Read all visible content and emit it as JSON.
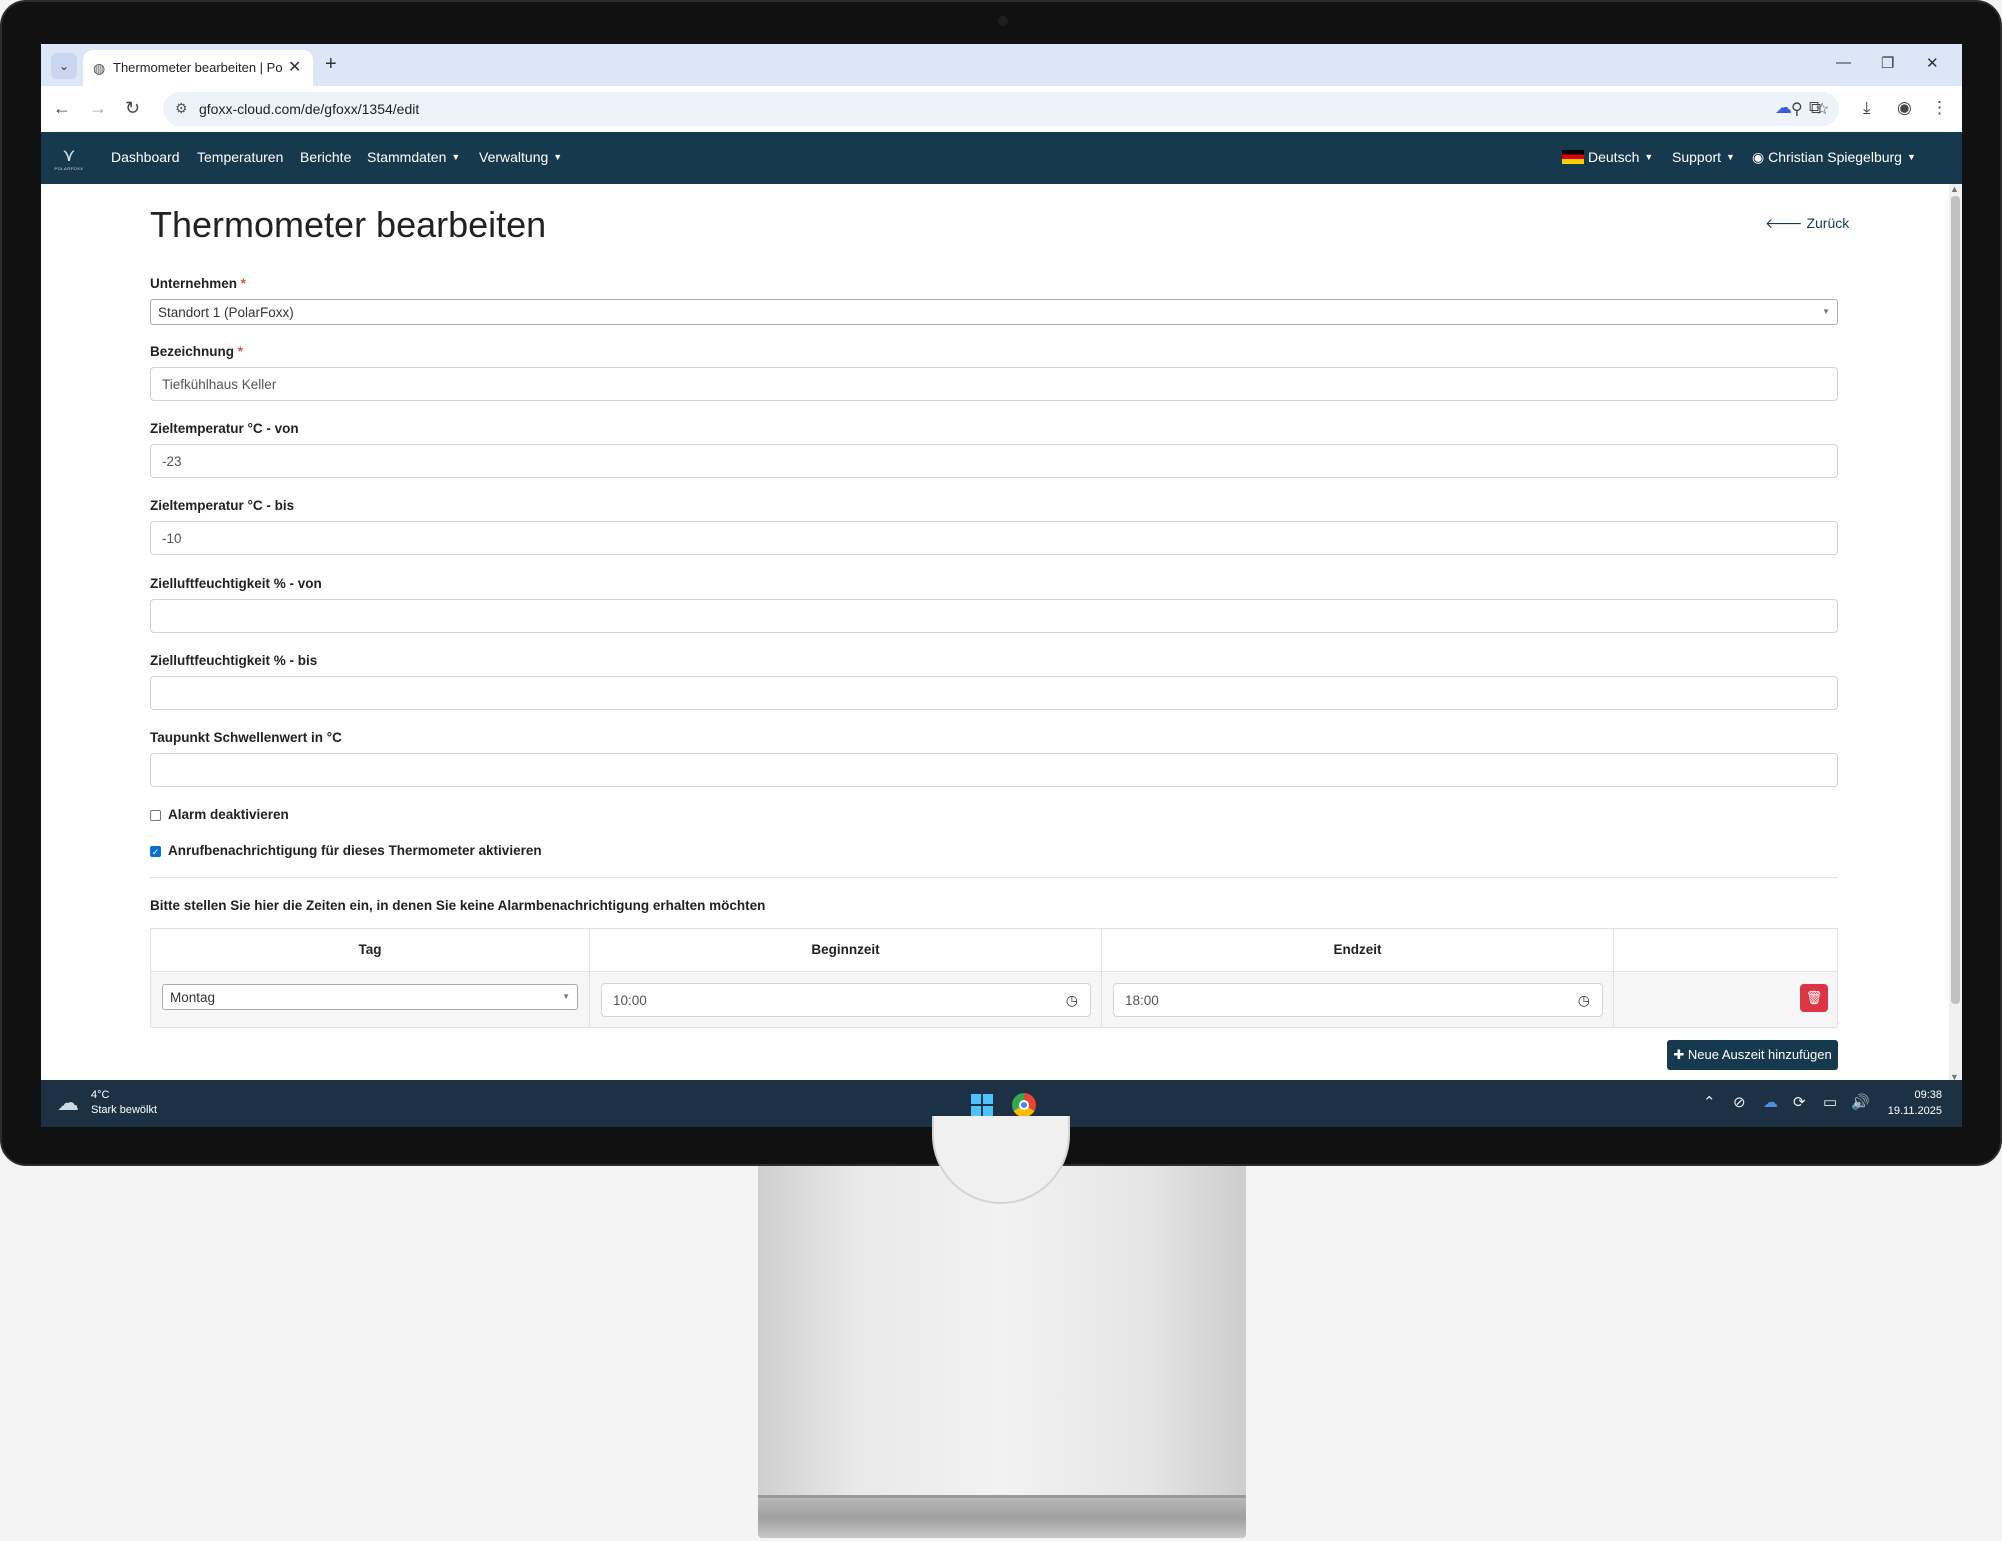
{
  "browser": {
    "tab_title": "Thermometer bearbeiten | Polar",
    "url": "gfoxx-cloud.com/de/gfoxx/1354/edit"
  },
  "navbar": {
    "logo_text": "POLARFOXX",
    "items": [
      {
        "label": "Dashboard"
      },
      {
        "label": "Temperaturen"
      },
      {
        "label": "Berichte"
      },
      {
        "label": "Stammdaten"
      },
      {
        "label": "Verwaltung"
      }
    ],
    "language": "Deutsch",
    "support": "Support",
    "user": "Christian Spiegelburg"
  },
  "page": {
    "title": "Thermometer bearbeiten",
    "back_label": "Zurück"
  },
  "form": {
    "company_label": "Unternehmen",
    "company_value": "Standort 1 (PolarFoxx)",
    "name_label": "Bezeichnung",
    "name_value": "Tiefkühlhaus Keller",
    "temp_from_label": "Zieltemperatur °C - von",
    "temp_from_value": "-23",
    "temp_to_label": "Zieltemperatur °C - bis",
    "temp_to_value": "-10",
    "hum_from_label": "Zielluftfeuchtigkeit % - von",
    "hum_from_value": "",
    "hum_to_label": "Zielluftfeuchtigkeit % - bis",
    "hum_to_value": "",
    "dew_label": "Taupunkt Schwellenwert in °C",
    "dew_value": "",
    "alarm_disable_label": "Alarm deaktivieren",
    "alarm_disable_checked": false,
    "call_notify_label": "Anrufbenachrichtigung für dieses Thermometer aktivieren",
    "call_notify_checked": true,
    "required_mark": "*"
  },
  "downtimes": {
    "note": "Bitte stellen Sie hier die Zeiten ein, in denen Sie keine Alarmbenachrichtigung erhalten möchten",
    "headers": {
      "day": "Tag",
      "start": "Beginnzeit",
      "end": "Endzeit"
    },
    "rows": [
      {
        "day": "Montag",
        "start": "10:00",
        "end": "18:00"
      }
    ],
    "add_label": "Neue Auszeit hinzufügen"
  },
  "taskbar": {
    "temperature": "4°C",
    "weather": "Stark bewölkt",
    "time": "09:38",
    "date": "19.11.2025"
  },
  "colors": {
    "navbar": "#17394d",
    "danger": "#dc3545",
    "checkbox": "#0b6fd8"
  }
}
